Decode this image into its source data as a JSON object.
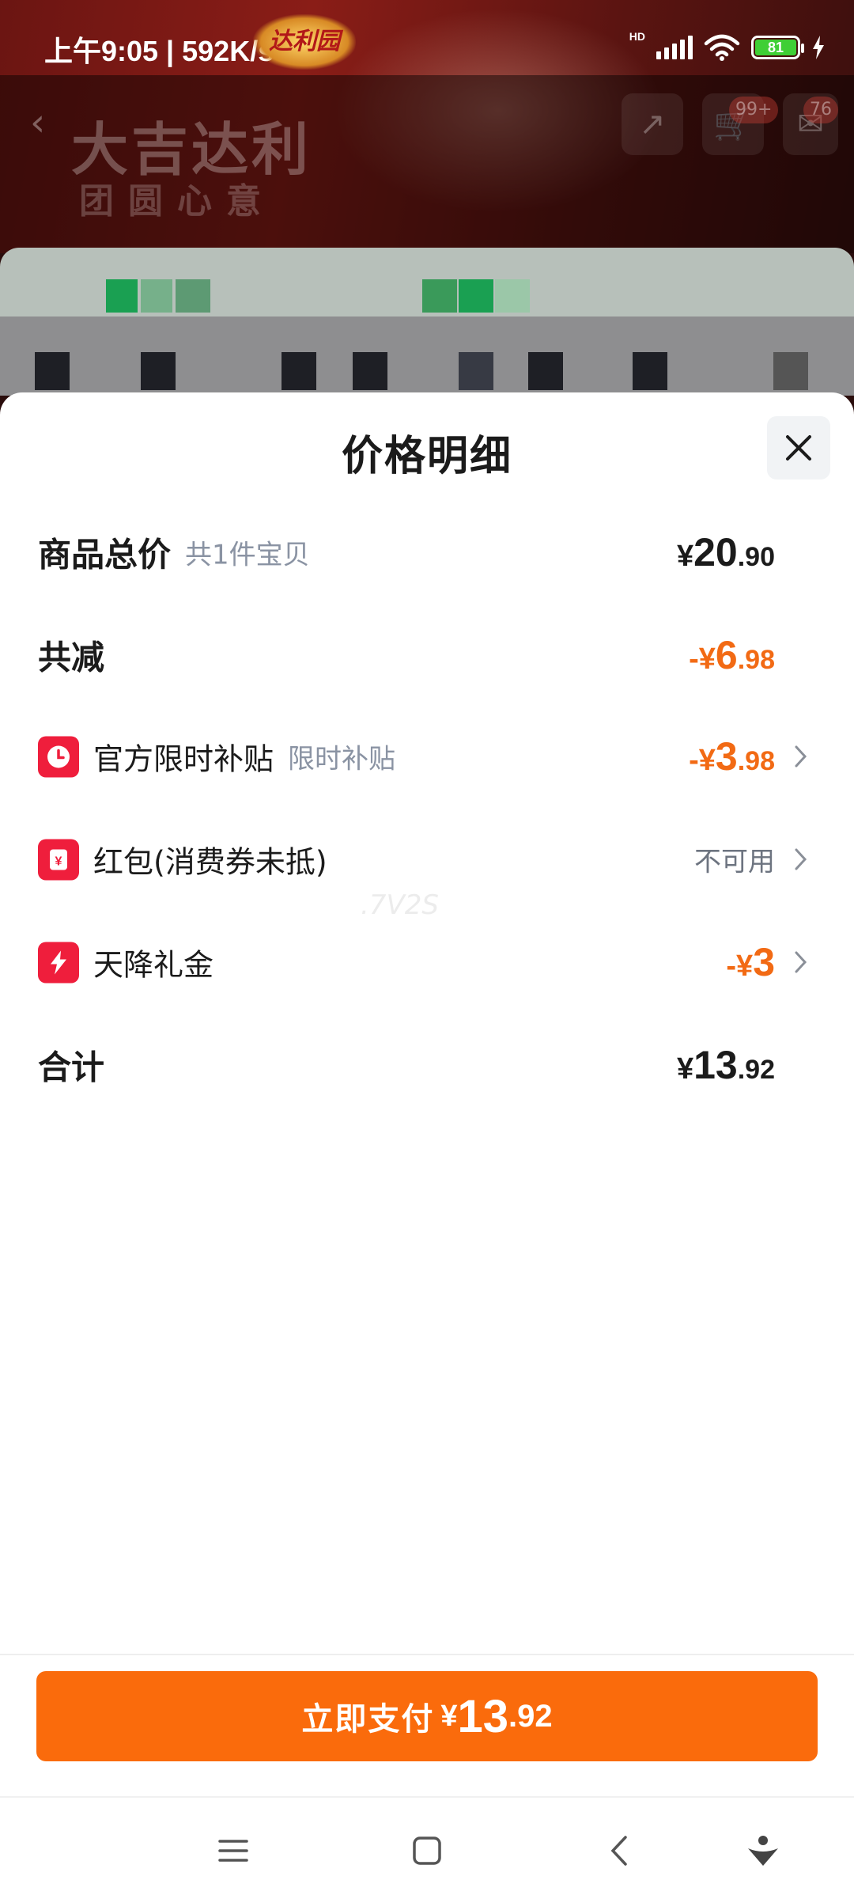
{
  "status_bar": {
    "time": "上午9:05 | 592K/s",
    "network": "HD",
    "battery": "81",
    "brand_logo": "达利园"
  },
  "background_page": {
    "brand_text": "大吉达利",
    "brand_sub": "团圆心意",
    "cart_badge": "99+",
    "message_badge": "76"
  },
  "sheet": {
    "title": "价格明细",
    "rows": [
      {
        "label": "商品总价",
        "sub": "共1件宝贝",
        "value": {
          "sign": "¥",
          "int": "20",
          "dec": ".90"
        }
      },
      {
        "label": "共减",
        "value": {
          "sign": "-¥",
          "int": "6",
          "dec": ".98"
        }
      },
      {
        "label": "官方限时补贴",
        "sub": "限时补贴",
        "icon": "clock-icon",
        "value": {
          "sign": "-¥",
          "int": "3",
          "dec": ".98"
        }
      },
      {
        "label": "红包(消费券未抵)",
        "icon": "red-packet-icon",
        "value_text": "不可用"
      },
      {
        "label": "天降礼金",
        "icon": "lightning-icon",
        "value": {
          "sign": "-¥",
          "int": "3",
          "dec": ""
        }
      },
      {
        "label": "合计",
        "value": {
          "sign": "¥",
          "int": "13",
          "dec": ".92"
        }
      }
    ],
    "watermark": ".7V2S"
  },
  "pay_button": {
    "label": "立即支付",
    "sign": "¥",
    "int": "13",
    "dec": ".92"
  },
  "colors": {
    "accent_orange": "#fa6b0c",
    "discount_orange": "#f26a14",
    "icon_red": "#ef1e3c"
  },
  "nav": {
    "icons": [
      "menu-icon",
      "home-icon",
      "back-icon",
      "assistant-icon"
    ]
  }
}
